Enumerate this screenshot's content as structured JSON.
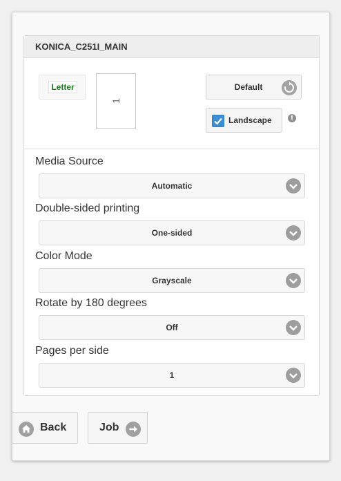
{
  "printer": {
    "name": "KONICA_C251I_MAIN"
  },
  "paper": {
    "size_label": "Letter"
  },
  "preview": {
    "page_number": "1"
  },
  "controls": {
    "default_label": "Default",
    "landscape_label": "Landscape",
    "landscape_checked": true
  },
  "fields": [
    {
      "label": "Media Source",
      "value": "Automatic"
    },
    {
      "label": "Double-sided printing",
      "value": "One-sided"
    },
    {
      "label": "Color Mode",
      "value": "Grayscale"
    },
    {
      "label": "Rotate by 180 degrees",
      "value": "Off"
    },
    {
      "label": "Pages per side",
      "value": "1"
    }
  ],
  "nav": {
    "back_label": "Back",
    "job_label": "Job"
  },
  "icons": {
    "refresh": "refresh-icon",
    "checkbox": "checkmark-icon",
    "info": "info-icon",
    "chevron": "chevron-down-icon",
    "back": "home-icon",
    "next": "arrow-right-icon"
  },
  "colors": {
    "accent": "#3f8ed4",
    "paper_text": "#1a7a1a"
  }
}
